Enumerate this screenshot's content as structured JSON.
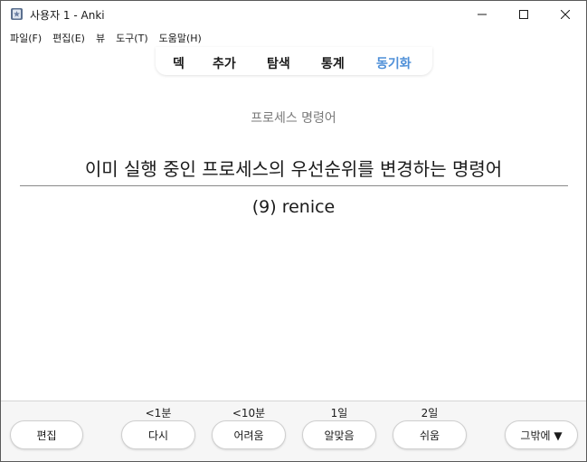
{
  "window": {
    "title": "사용자 1 - Anki"
  },
  "menu": {
    "items": [
      "파일(F)",
      "편집(E)",
      "뷰",
      "도구(T)",
      "도움말(H)"
    ]
  },
  "toolbar": {
    "tabs": [
      {
        "label": "덱",
        "active": false
      },
      {
        "label": "추가",
        "active": false
      },
      {
        "label": "탐색",
        "active": false
      },
      {
        "label": "통계",
        "active": false
      },
      {
        "label": "동기화",
        "active": true
      }
    ],
    "active_color": "#4e8fd8"
  },
  "card": {
    "deck_label": "프로세스 명령어",
    "front": "이미 실행 중인 프로세스의 우선순위를 변경하는 명령어",
    "back": "(9) renice"
  },
  "reviewer": {
    "edit_label": "편집",
    "more_label": "그밖에 ▼",
    "answers": [
      {
        "interval": "<1분",
        "label": "다시"
      },
      {
        "interval": "<10분",
        "label": "어려움"
      },
      {
        "interval": "1일",
        "label": "알맞음"
      },
      {
        "interval": "2일",
        "label": "쉬움"
      }
    ]
  },
  "icons": {
    "app": "anki-app-icon",
    "minimize": "minimize-icon",
    "maximize": "maximize-icon",
    "close": "close-icon"
  }
}
